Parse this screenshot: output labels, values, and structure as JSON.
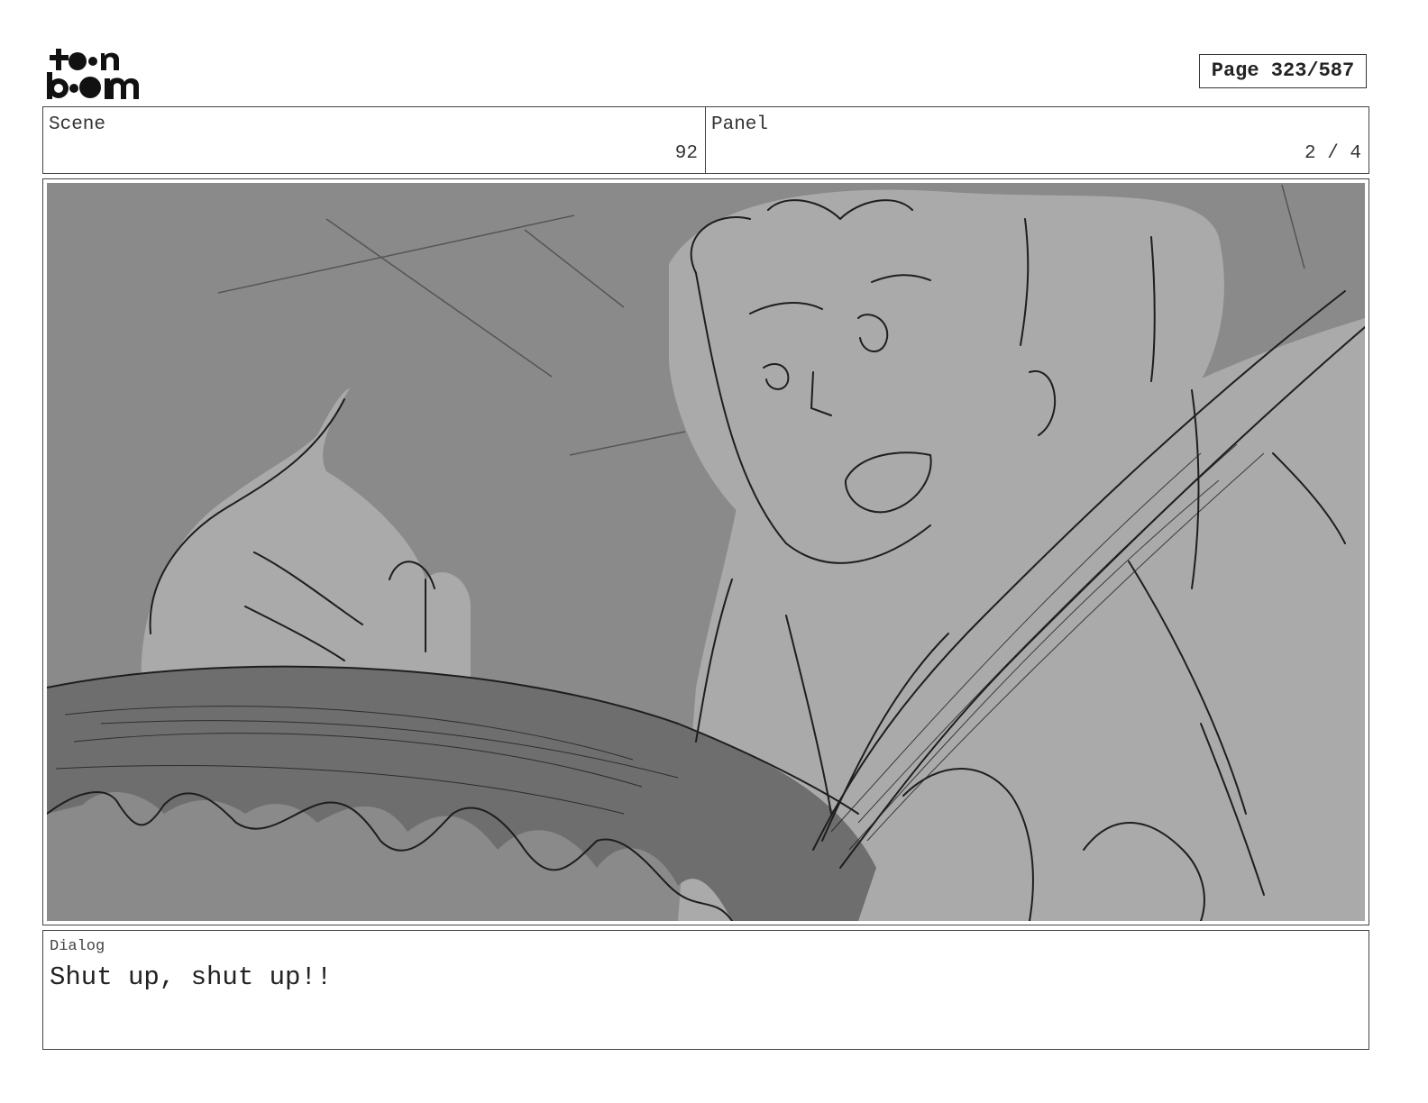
{
  "brand": {
    "logo_line1": "toon",
    "logo_line2": "boom"
  },
  "page": {
    "label": "Page 323/587"
  },
  "scene": {
    "label": "Scene",
    "value": "92"
  },
  "panel": {
    "label": "Panel",
    "value": "2 / 4"
  },
  "dialog": {
    "label": "Dialog",
    "text": "Shut up, shut up!!"
  },
  "colors": {
    "background": "#8a8a8a",
    "figure": "#aaaaaa",
    "prop": "#6e6e6e",
    "line": "#1e1e1e"
  }
}
